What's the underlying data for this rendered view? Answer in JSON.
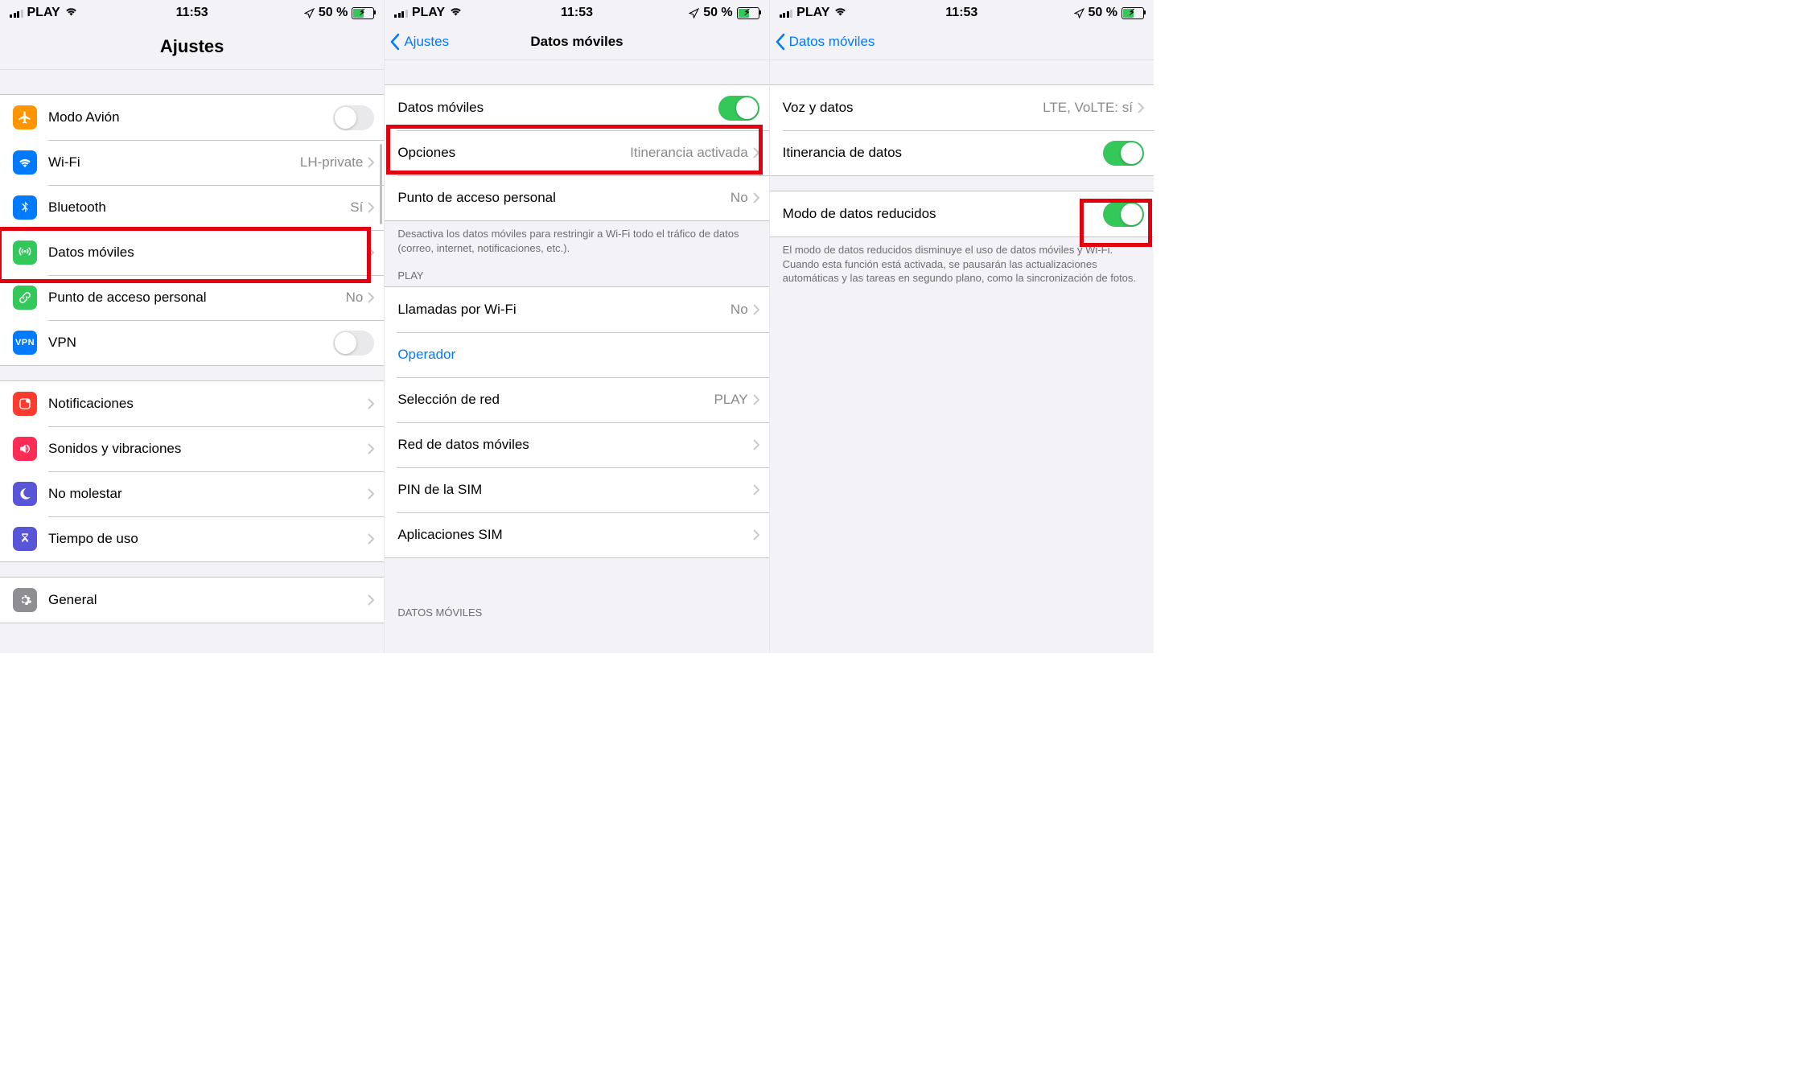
{
  "status": {
    "carrier": "PLAY",
    "time": "11:53",
    "battery": "50 %"
  },
  "s1": {
    "title": "Ajustes",
    "rows": {
      "airplane": "Modo Avión",
      "wifi": "Wi-Fi",
      "wifi_val": "LH-private",
      "bt": "Bluetooth",
      "bt_val": "Sí",
      "cell": "Datos móviles",
      "hotspot": "Punto de acceso personal",
      "hotspot_val": "No",
      "vpn": "VPN",
      "notif": "Notificaciones",
      "sounds": "Sonidos y vibraciones",
      "dnd": "No molestar",
      "screentime": "Tiempo de uso",
      "general": "General"
    }
  },
  "s2": {
    "back": "Ajustes",
    "title": "Datos móviles",
    "rows": {
      "cell": "Datos móviles",
      "options": "Opciones",
      "options_val": "Itinerancia activada",
      "hotspot": "Punto de acceso personal",
      "hotspot_val": "No"
    },
    "footer1": "Desactiva los datos móviles para restringir a Wi-Fi todo el tráfico de datos (correo, internet, notificaciones, etc.).",
    "header_play": "PLAY",
    "rows2": {
      "wificall": "Llamadas por Wi-Fi",
      "wificall_val": "No",
      "operator": "Operador",
      "netsel": "Selección de red",
      "netsel_val": "PLAY",
      "netdata": "Red de datos móviles",
      "simpin": "PIN de la SIM",
      "simapps": "Aplicaciones SIM"
    },
    "header_data": "DATOS MÓVILES"
  },
  "s3": {
    "back": "Datos móviles",
    "rows": {
      "voice": "Voz y datos",
      "voice_val": "LTE, VoLTE: sí",
      "roaming": "Itinerancia de datos",
      "lowdata": "Modo de datos reducidos"
    },
    "footer": "El modo de datos reducidos disminuye el uso de datos móviles y Wi-Fi. Cuando esta función está activada, se pausarán las actualizaciones automáticas y las tareas en segundo plano, como la sincronización de fotos."
  }
}
